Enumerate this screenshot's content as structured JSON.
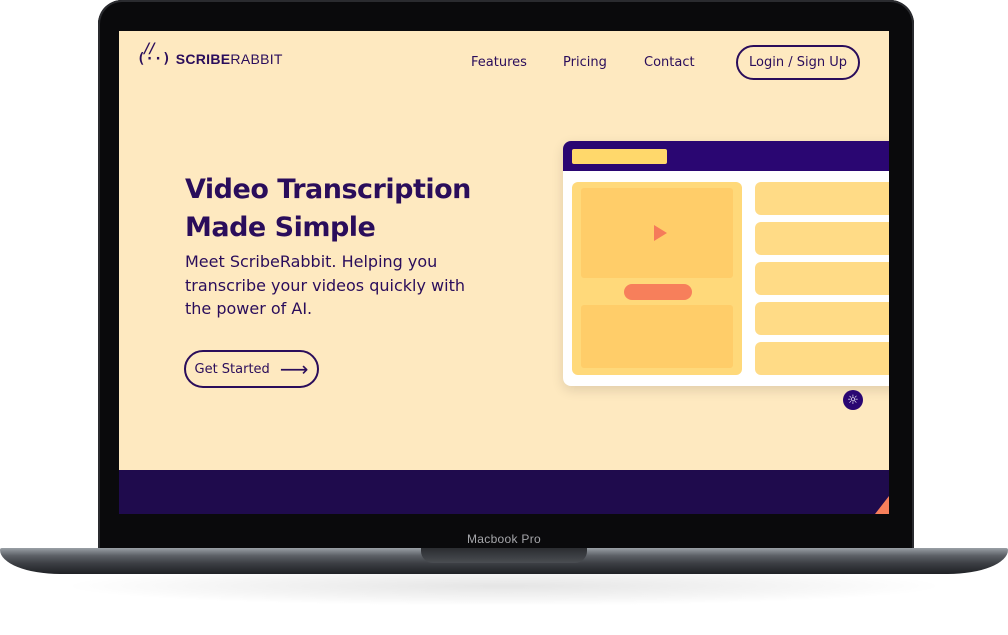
{
  "device": {
    "label": "Macbook Pro"
  },
  "brand": {
    "logo_mark": "(··)",
    "logo_ears": "//",
    "name_bold": "SCRIBE",
    "name_light": "RABBIT"
  },
  "nav": {
    "links": [
      "Features",
      "Pricing",
      "Contact"
    ],
    "login_label": "Login / Sign Up"
  },
  "hero": {
    "title": "Video Transcription Made Simple",
    "subtitle": "Meet ScribeRabbit. Helping you transcribe your videos quickly with the power of AI.",
    "cta_label": "Get Started",
    "cta_icon": "arrow-right-icon"
  },
  "colors": {
    "background": "#fee9c0",
    "brand_dark": "#2a0d5b",
    "accent_orange": "#f77f5b",
    "accent_yellow": "#ffd86b",
    "band": "#1f0b4d"
  }
}
